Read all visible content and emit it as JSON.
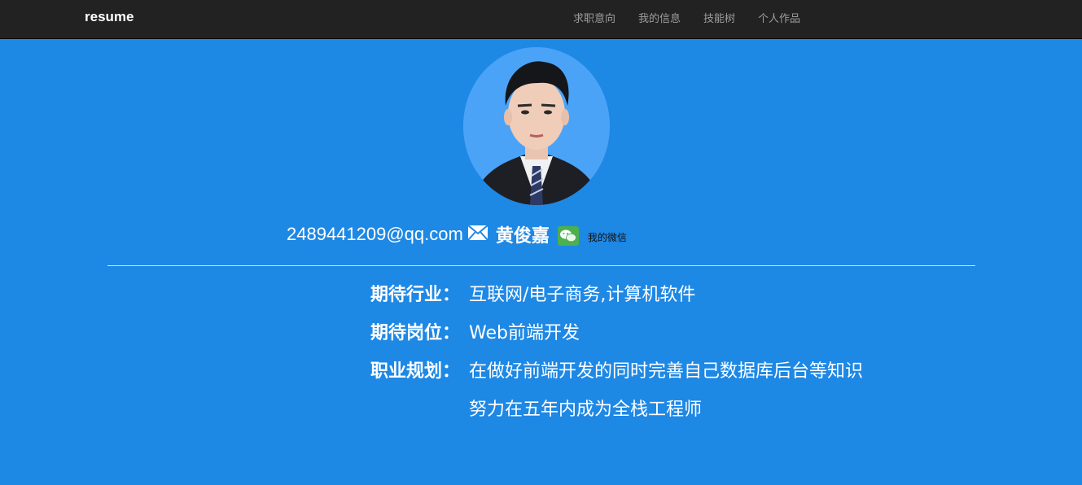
{
  "navbar": {
    "brand": "resume",
    "links": [
      "求职意向",
      "我的信息",
      "技能树",
      "个人作品"
    ]
  },
  "profile": {
    "email": "2489441209@qq.com",
    "name": "黄俊嘉",
    "wechat_label": "我的微信",
    "mail_icon": "envelope-icon",
    "wechat_icon": "wechat-icon"
  },
  "intent": {
    "industry_label": "期待行业：",
    "industry_value": "互联网/电子商务,计算机软件",
    "position_label": "期待岗位：",
    "position_value": "Web前端开发",
    "plan_label": "职业规划：",
    "plan_value_line1": "在做好前端开发的同时完善自己数据库后台等知识",
    "plan_value_line2": "努力在五年内成为全栈工程师"
  },
  "colors": {
    "navbar_bg": "#222222",
    "page_bg": "#1e88e5",
    "avatar_bg": "#4aa3f7",
    "wechat_green": "#4caf50"
  }
}
